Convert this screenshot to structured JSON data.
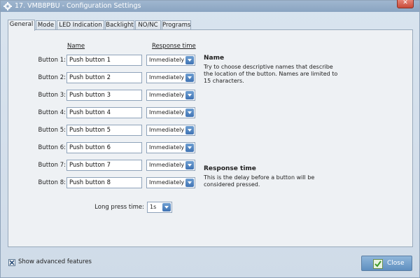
{
  "window": {
    "title": "17. VMB8PBU - Configuration Settings"
  },
  "tabs": [
    {
      "label": "General",
      "active": true
    },
    {
      "label": "Mode",
      "active": false
    },
    {
      "label": "LED Indication",
      "active": false
    },
    {
      "label": "Backlight",
      "active": false
    },
    {
      "label": "NO/NC",
      "active": false
    },
    {
      "label": "Programs",
      "active": false
    }
  ],
  "columns": {
    "name": "Name",
    "response": "Response time"
  },
  "buttons": [
    {
      "label": "Button 1:",
      "name": "Push button 1",
      "response": "Immediately"
    },
    {
      "label": "Button 2:",
      "name": "Push button 2",
      "response": "Immediately"
    },
    {
      "label": "Button 3:",
      "name": "Push button 3",
      "response": "Immediately"
    },
    {
      "label": "Button 4:",
      "name": "Push button 4",
      "response": "Immediately"
    },
    {
      "label": "Button 5:",
      "name": "Push button 5",
      "response": "Immediately"
    },
    {
      "label": "Button 6:",
      "name": "Push button 6",
      "response": "Immediately"
    },
    {
      "label": "Button 7:",
      "name": "Push button 7",
      "response": "Immediately"
    },
    {
      "label": "Button 8:",
      "name": "Push button 8",
      "response": "Immediately"
    }
  ],
  "long_press": {
    "label": "Long press time:",
    "value": "1s"
  },
  "help": {
    "name_title": "Name",
    "name_text": "Try to choose descriptive names that describe the location of the button. Names are limited to 15 characters.",
    "response_title": "Response time",
    "response_text": "This is the delay before a button will be considered pressed."
  },
  "footer": {
    "advanced_label": "Show advanced features",
    "advanced_checked": true,
    "close_label": "Close"
  },
  "colors": {
    "accent": "#3f73b4",
    "title_bar": "#8aa4c1",
    "panel": "#eef1f4"
  }
}
